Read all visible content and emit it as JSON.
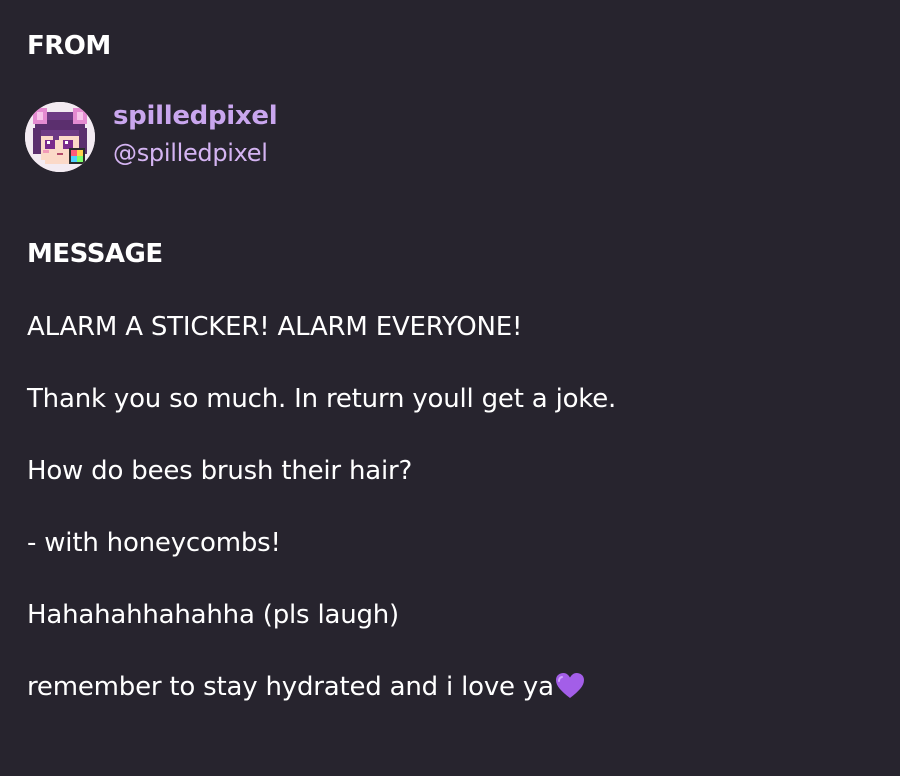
{
  "from_label": "FROM",
  "sender": {
    "display_name": "spilledpixel",
    "handle": "@spilledpixel",
    "avatar_icon": "pixel-art-avatar"
  },
  "message_label": "MESSAGE",
  "message_lines": [
    "ALARM A STICKER! ALARM EVERYONE!",
    "Thank you so much. In return youll get a joke.",
    "How do bees brush their hair?",
    "- with honeycombs!",
    "Hahahahhahahha (pls laugh)",
    "remember to stay hydrated and i love ya"
  ],
  "emoji": "purple-heart-icon",
  "colors": {
    "background": "#27242e",
    "name_accent": "#c9a6ee",
    "heart": "#a35ee8"
  }
}
